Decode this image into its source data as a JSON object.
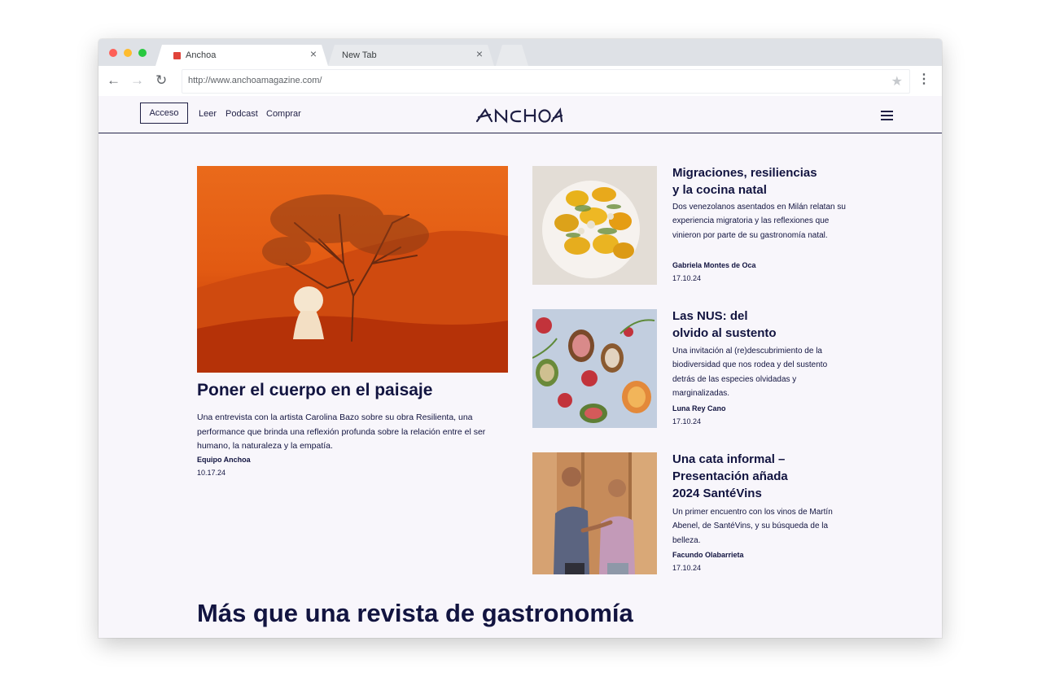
{
  "browser": {
    "tabs": [
      {
        "label": "Anchoa",
        "active": true
      },
      {
        "label": "New Tab",
        "active": false
      }
    ],
    "close_glyph": "×",
    "url": "http://www.anchoamagazine.com/",
    "icons": {
      "back": "←",
      "forward": "→",
      "reload": "↻",
      "star": "★",
      "menu": "⋮"
    }
  },
  "site": {
    "login_label": "Acceso",
    "nav": [
      "Leer",
      "Podcast",
      "Comprar"
    ],
    "logo_text": "ANCHOA",
    "colors": {
      "navy": "#121440",
      "page_bg": "#f8f6fb",
      "feature_orange": "#e2560f"
    }
  },
  "feature": {
    "title": "Poner el cuerpo en el paisaje",
    "description": "Una entrevista con la artista Carolina Bazo sobre su obra Resilienta, una performance que brinda una reflexión profunda sobre la relación entre el ser humano, la naturaleza y la empatía.",
    "author": "Equipo Anchoa",
    "date": "10.17.24"
  },
  "articles": [
    {
      "title_lines": [
        "Migraciones, resiliencias",
        "y la cocina natal"
      ],
      "description": "Dos venezolanos asentados en Milán relatan su experiencia migratoria y las reflexiones que vinieron por parte de su gastronomía natal.",
      "author": "Gabriela Montes de Oca",
      "date": "17.10.24"
    },
    {
      "title_lines": [
        "Las NUS: del",
        "olvido al sustento"
      ],
      "description": "Una invitación al (re)descubrimiento de la biodiversidad que nos rodea y del sustento detrás de las especies olvidadas y marginalizadas.",
      "author": "Luna Rey Cano",
      "date": "17.10.24"
    },
    {
      "title_lines": [
        "Una cata informal –",
        "Presentación añada",
        "2024 SantéVins"
      ],
      "description": "Un primer encuentro con los vinos de Martín Abenel, de SantéVins, y su búsqueda de la belleza.",
      "author": "Facundo Olabarrieta",
      "date": "17.10.24"
    }
  ],
  "section": {
    "heading": "Más que una revista de gastronomía"
  }
}
